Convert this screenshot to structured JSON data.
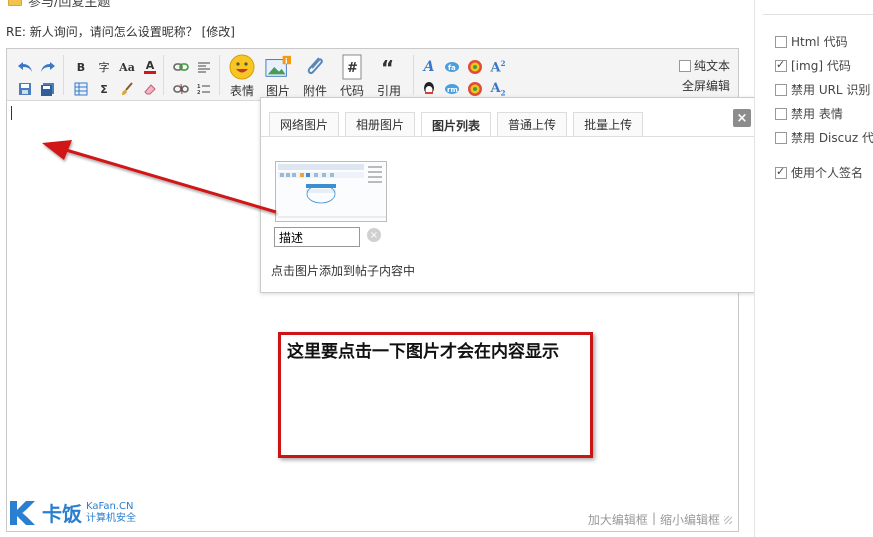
{
  "page": {
    "title": "参与/回复主题",
    "subject_prefix": "RE: 新人询问，请问怎么设置昵称？",
    "subject_edit": "[修改]"
  },
  "toolbar": {
    "big_buttons": [
      {
        "label": "表情",
        "icon": "smiley-icon"
      },
      {
        "label": "图片",
        "icon": "image-icon"
      },
      {
        "label": "附件",
        "icon": "paperclip-icon"
      },
      {
        "label": "代码",
        "icon": "code-icon"
      },
      {
        "label": "引用",
        "icon": "quote-icon"
      }
    ],
    "plain_text_label": "纯文本",
    "fullscreen_label": "全屏编辑",
    "glyphs": {
      "bold": "B",
      "font": "字",
      "size": "Aa",
      "color": "A",
      "sigma": "Σ"
    }
  },
  "image_popup": {
    "tabs": [
      "网络图片",
      "相册图片",
      "图片列表",
      "普通上传",
      "批量上传"
    ],
    "active_tab": 2,
    "close_label": "×",
    "description_value": "描述",
    "hint": "点击图片添加到帖子内容中"
  },
  "annotation": {
    "text": "这里要点击一下图片才会在内容显示",
    "arrow_color": "#d01818",
    "box_color": "#cc1414"
  },
  "statusbar": {
    "enlarge": "加大编辑框",
    "separator": "|",
    "shrink": "缩小编辑框"
  },
  "options": {
    "items": [
      {
        "label": "Html 代码",
        "checked": false
      },
      {
        "label": "[img] 代码",
        "checked": true
      },
      {
        "label": "禁用 URL 识别",
        "checked": false
      },
      {
        "label": "禁用 表情",
        "checked": false
      },
      {
        "label": "禁用 Discuz 代码",
        "checked": false
      },
      {
        "label": "使用个人签名",
        "checked": true
      }
    ]
  },
  "watermark": {
    "brand": "卡饭",
    "domain": "KaFan.CN",
    "tagline": "计算机安全"
  }
}
